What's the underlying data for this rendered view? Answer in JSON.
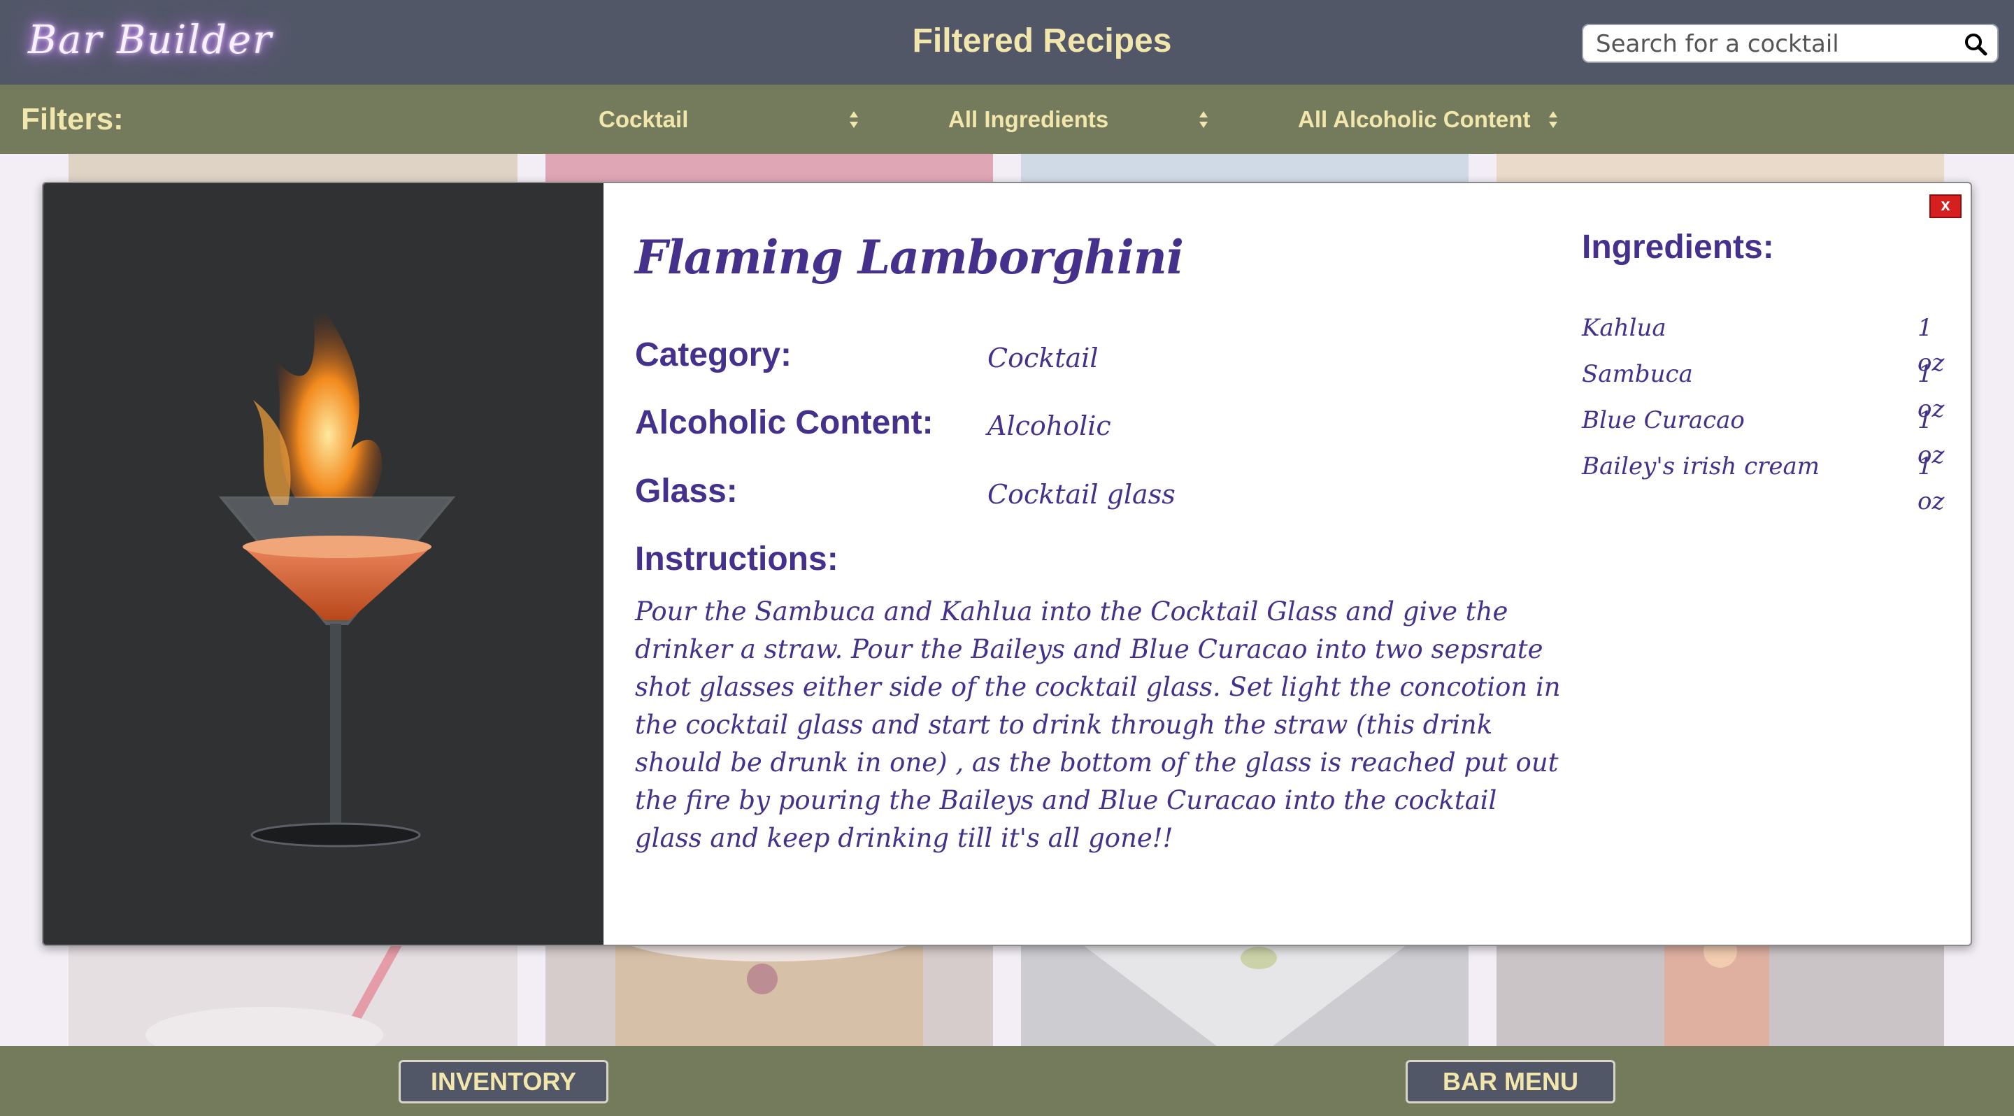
{
  "header": {
    "logo": "Bar Builder",
    "title": "Filtered Recipes",
    "search_placeholder": "Search for a cocktail"
  },
  "filters": {
    "label": "Filters:",
    "category": "Cocktail",
    "ingredients": "All Ingredients",
    "alcoholic": "All Alcoholic Content"
  },
  "modal": {
    "close_label": "x",
    "name": "Flaming Lamborghini",
    "category_label": "Category:",
    "category_value": "Cocktail",
    "alcoholic_label": "Alcoholic Content:",
    "alcoholic_value": "Alcoholic",
    "glass_label": "Glass:",
    "glass_value": "Cocktail glass",
    "instructions_label": "Instructions:",
    "instructions": "Pour the Sambuca and Kahlua into the Cocktail Glass and give the drinker a straw. Pour the Baileys and Blue Curacao into two sepsrate shot glasses either side of the cocktail glass. Set light the concotion in the cocktail glass and start to drink through the straw (this drink should be drunk in one) , as the bottom of the glass is reached put out the fire by pouring the Baileys and Blue Curacao into the cocktail glass and keep drinking till it's all gone!!",
    "ingredients_label": "Ingredients:",
    "ingredients": [
      {
        "name": "Kahlua",
        "amount": "1 oz"
      },
      {
        "name": "Sambuca",
        "amount": "1 oz"
      },
      {
        "name": "Blue Curacao",
        "amount": "1 oz"
      },
      {
        "name": "Bailey's irish cream",
        "amount": "1 oz"
      }
    ]
  },
  "footer": {
    "inventory": "INVENTORY",
    "bar_menu": "BAR MENU"
  }
}
